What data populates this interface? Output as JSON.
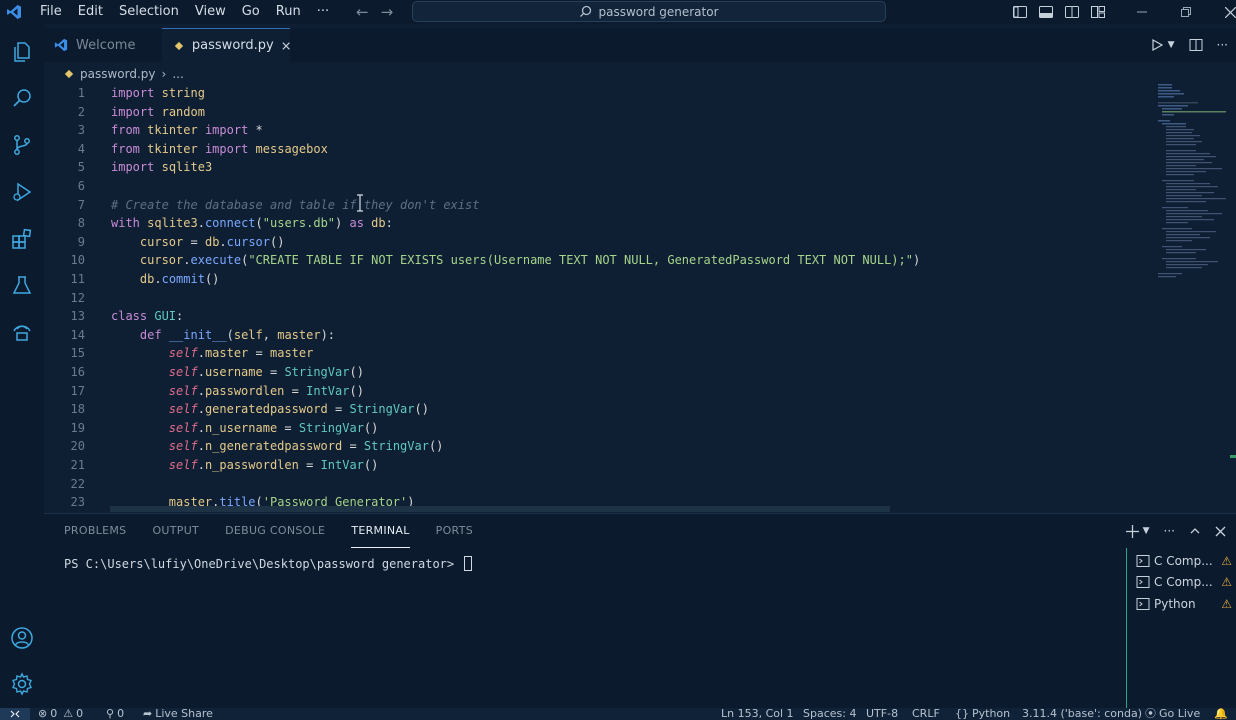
{
  "titlebar": {
    "menus": [
      "File",
      "Edit",
      "Selection",
      "View",
      "Go",
      "Run",
      "···"
    ],
    "search": "password generator"
  },
  "tabs": [
    {
      "label": "Welcome"
    },
    {
      "label": "password.py"
    }
  ],
  "breadcrumb": {
    "file": "password.py",
    "more": "..."
  },
  "code_lines": [
    {
      "n": "1",
      "tokens": [
        [
          "kw",
          "import"
        ],
        [
          "txt",
          " "
        ],
        [
          "mod",
          "string"
        ]
      ]
    },
    {
      "n": "2",
      "tokens": [
        [
          "kw",
          "import"
        ],
        [
          "txt",
          " "
        ],
        [
          "mod",
          "random"
        ]
      ]
    },
    {
      "n": "3",
      "tokens": [
        [
          "kw",
          "from"
        ],
        [
          "txt",
          " "
        ],
        [
          "mod",
          "tkinter"
        ],
        [
          "txt",
          " "
        ],
        [
          "kw",
          "import"
        ],
        [
          "txt",
          " "
        ],
        [
          "punc",
          "*"
        ]
      ]
    },
    {
      "n": "4",
      "tokens": [
        [
          "kw",
          "from"
        ],
        [
          "txt",
          " "
        ],
        [
          "mod",
          "tkinter"
        ],
        [
          "txt",
          " "
        ],
        [
          "kw",
          "import"
        ],
        [
          "txt",
          " "
        ],
        [
          "mod",
          "messagebox"
        ]
      ]
    },
    {
      "n": "5",
      "tokens": [
        [
          "kw",
          "import"
        ],
        [
          "txt",
          " "
        ],
        [
          "mod",
          "sqlite3"
        ]
      ]
    },
    {
      "n": "6",
      "tokens": []
    },
    {
      "n": "7",
      "tokens": [
        [
          "cm",
          "# Create the database and table if they don't exist"
        ]
      ]
    },
    {
      "n": "8",
      "tokens": [
        [
          "kw",
          "with"
        ],
        [
          "txt",
          " "
        ],
        [
          "mod",
          "sqlite3"
        ],
        [
          "punc",
          "."
        ],
        [
          "fn",
          "connect"
        ],
        [
          "punc",
          "("
        ],
        [
          "str",
          "\"users.db\""
        ],
        [
          "punc",
          ")"
        ],
        [
          "txt",
          " "
        ],
        [
          "kw",
          "as"
        ],
        [
          "txt",
          " "
        ],
        [
          "var",
          "db"
        ],
        [
          "punc",
          ":"
        ]
      ]
    },
    {
      "n": "9",
      "tokens": [
        [
          "txt",
          "    "
        ],
        [
          "var",
          "cursor"
        ],
        [
          "txt",
          " "
        ],
        [
          "punc",
          "="
        ],
        [
          "txt",
          " "
        ],
        [
          "var",
          "db"
        ],
        [
          "punc",
          "."
        ],
        [
          "fn",
          "cursor"
        ],
        [
          "punc",
          "()"
        ]
      ]
    },
    {
      "n": "10",
      "tokens": [
        [
          "txt",
          "    "
        ],
        [
          "var",
          "cursor"
        ],
        [
          "punc",
          "."
        ],
        [
          "fn",
          "execute"
        ],
        [
          "punc",
          "("
        ],
        [
          "str",
          "\"CREATE TABLE IF NOT EXISTS users(Username TEXT NOT NULL, GeneratedPassword TEXT NOT NULL);\""
        ],
        [
          "punc",
          ")"
        ]
      ]
    },
    {
      "n": "11",
      "tokens": [
        [
          "txt",
          "    "
        ],
        [
          "var",
          "db"
        ],
        [
          "punc",
          "."
        ],
        [
          "fn",
          "commit"
        ],
        [
          "punc",
          "()"
        ]
      ]
    },
    {
      "n": "12",
      "tokens": []
    },
    {
      "n": "13",
      "tokens": [
        [
          "kw",
          "class"
        ],
        [
          "txt",
          " "
        ],
        [
          "cls",
          "GUI"
        ],
        [
          "punc",
          ":"
        ]
      ]
    },
    {
      "n": "14",
      "tokens": [
        [
          "txt",
          "    "
        ],
        [
          "kw",
          "def"
        ],
        [
          "txt",
          " "
        ],
        [
          "fn",
          "__init__"
        ],
        [
          "punc",
          "("
        ],
        [
          "var",
          "self"
        ],
        [
          "punc",
          ", "
        ],
        [
          "var",
          "master"
        ],
        [
          "punc",
          "):"
        ]
      ]
    },
    {
      "n": "15",
      "tokens": [
        [
          "txt",
          "        "
        ],
        [
          "slf",
          "self"
        ],
        [
          "punc",
          "."
        ],
        [
          "var",
          "master"
        ],
        [
          "txt",
          " "
        ],
        [
          "punc",
          "="
        ],
        [
          "txt",
          " "
        ],
        [
          "var",
          "master"
        ]
      ]
    },
    {
      "n": "16",
      "tokens": [
        [
          "txt",
          "        "
        ],
        [
          "slf",
          "self"
        ],
        [
          "punc",
          "."
        ],
        [
          "var",
          "username"
        ],
        [
          "txt",
          " "
        ],
        [
          "punc",
          "="
        ],
        [
          "txt",
          " "
        ],
        [
          "cls",
          "StringVar"
        ],
        [
          "punc",
          "()"
        ]
      ]
    },
    {
      "n": "17",
      "tokens": [
        [
          "txt",
          "        "
        ],
        [
          "slf",
          "self"
        ],
        [
          "punc",
          "."
        ],
        [
          "var",
          "passwordlen"
        ],
        [
          "txt",
          " "
        ],
        [
          "punc",
          "="
        ],
        [
          "txt",
          " "
        ],
        [
          "cls",
          "IntVar"
        ],
        [
          "punc",
          "()"
        ]
      ]
    },
    {
      "n": "18",
      "tokens": [
        [
          "txt",
          "        "
        ],
        [
          "slf",
          "self"
        ],
        [
          "punc",
          "."
        ],
        [
          "var",
          "generatedpassword"
        ],
        [
          "txt",
          " "
        ],
        [
          "punc",
          "="
        ],
        [
          "txt",
          " "
        ],
        [
          "cls",
          "StringVar"
        ],
        [
          "punc",
          "()"
        ]
      ]
    },
    {
      "n": "19",
      "tokens": [
        [
          "txt",
          "        "
        ],
        [
          "slf",
          "self"
        ],
        [
          "punc",
          "."
        ],
        [
          "var",
          "n_username"
        ],
        [
          "txt",
          " "
        ],
        [
          "punc",
          "="
        ],
        [
          "txt",
          " "
        ],
        [
          "cls",
          "StringVar"
        ],
        [
          "punc",
          "()"
        ]
      ]
    },
    {
      "n": "20",
      "tokens": [
        [
          "txt",
          "        "
        ],
        [
          "slf",
          "self"
        ],
        [
          "punc",
          "."
        ],
        [
          "var",
          "n_generatedpassword"
        ],
        [
          "txt",
          " "
        ],
        [
          "punc",
          "="
        ],
        [
          "txt",
          " "
        ],
        [
          "cls",
          "StringVar"
        ],
        [
          "punc",
          "()"
        ]
      ]
    },
    {
      "n": "21",
      "tokens": [
        [
          "txt",
          "        "
        ],
        [
          "slf",
          "self"
        ],
        [
          "punc",
          "."
        ],
        [
          "var",
          "n_passwordlen"
        ],
        [
          "txt",
          " "
        ],
        [
          "punc",
          "="
        ],
        [
          "txt",
          " "
        ],
        [
          "cls",
          "IntVar"
        ],
        [
          "punc",
          "()"
        ]
      ]
    },
    {
      "n": "22",
      "tokens": []
    },
    {
      "n": "23",
      "tokens": [
        [
          "txt",
          "        "
        ],
        [
          "var",
          "master"
        ],
        [
          "punc",
          "."
        ],
        [
          "fn",
          "title"
        ],
        [
          "punc",
          "("
        ],
        [
          "str",
          "'Password Generator'"
        ],
        [
          "punc",
          ")"
        ]
      ]
    }
  ],
  "panel": {
    "tabs": [
      "PROBLEMS",
      "OUTPUT",
      "DEBUG CONSOLE",
      "TERMINAL",
      "PORTS"
    ],
    "active_tab": "TERMINAL",
    "prompt": "PS C:\\Users\\lufiy\\OneDrive\\Desktop\\password generator> ",
    "terminals": [
      "C Comp...",
      "C Comp...",
      "Python"
    ]
  },
  "statusbar": {
    "errors": "0",
    "warnings": "0",
    "info": "0",
    "live_share": "Live Share",
    "position": "Ln 153, Col 1",
    "spaces": "Spaces: 4",
    "encoding": "UTF-8",
    "eol": "CRLF",
    "language": "Python",
    "interpreter": "3.11.4 ('base': conda)",
    "go_live": "Go Live"
  },
  "colors": {
    "background": "#0f1f33",
    "chrome": "#0b1a2c",
    "accent": "#2aa98a",
    "vscode_blue": "#3a8ee6",
    "warning": "#e2a93b"
  },
  "icons": {
    "activity": [
      "explorer-icon",
      "search-icon",
      "source-control-icon",
      "run-debug-icon",
      "extensions-icon",
      "testing-icon",
      "remote-explorer-icon",
      "account-icon",
      "settings-gear-icon"
    ]
  }
}
